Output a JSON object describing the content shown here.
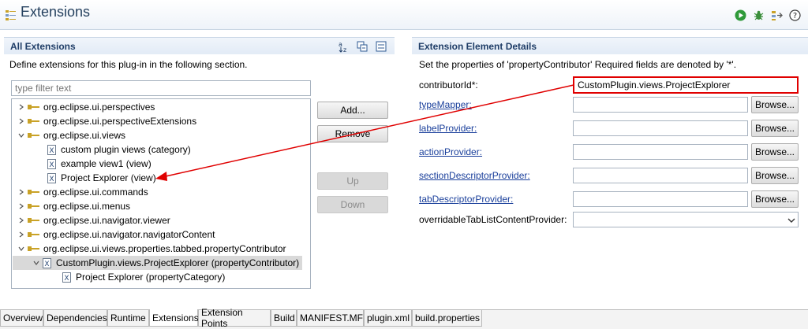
{
  "editor": {
    "title": "Extensions",
    "toolbar_icons": [
      "run-icon",
      "debug-icon",
      "export-icon",
      "help-icon"
    ]
  },
  "left_panel": {
    "header": "All Extensions",
    "description": "Define extensions for this plug-in in the following section.",
    "filter_placeholder": "type filter text",
    "icons": [
      "sort-alpha-icon",
      "collapse-all-icon",
      "show-description-icon"
    ],
    "tree": [
      {
        "label": "org.eclipse.ui.perspectives",
        "kind": "extension",
        "expander": "collapsed",
        "depth": 0
      },
      {
        "label": "org.eclipse.ui.perspectiveExtensions",
        "kind": "extension",
        "expander": "collapsed",
        "depth": 0
      },
      {
        "label": "org.eclipse.ui.views",
        "kind": "extension",
        "expander": "expanded",
        "depth": 0
      },
      {
        "label": "custom plugin views (category)",
        "kind": "element",
        "expander": "none",
        "depth": 1
      },
      {
        "label": "example view1 (view)",
        "kind": "element",
        "expander": "none",
        "depth": 1
      },
      {
        "label": "Project Explorer (view)",
        "kind": "element",
        "expander": "none",
        "depth": 1
      },
      {
        "label": "org.eclipse.ui.commands",
        "kind": "extension",
        "expander": "collapsed",
        "depth": 0
      },
      {
        "label": "org.eclipse.ui.menus",
        "kind": "extension",
        "expander": "collapsed",
        "depth": 0
      },
      {
        "label": "org.eclipse.ui.navigator.viewer",
        "kind": "extension",
        "expander": "collapsed",
        "depth": 0
      },
      {
        "label": "org.eclipse.ui.navigator.navigatorContent",
        "kind": "extension",
        "expander": "collapsed",
        "depth": 0
      },
      {
        "label": "org.eclipse.ui.views.properties.tabbed.propertyContributor",
        "kind": "extension",
        "expander": "expanded",
        "depth": 0
      },
      {
        "label": "CustomPlugin.views.ProjectExplorer (propertyContributor)",
        "kind": "element",
        "expander": "expanded",
        "depth": 1,
        "selected": true
      },
      {
        "label": "Project Explorer (propertyCategory)",
        "kind": "element",
        "expander": "none",
        "depth": 2
      }
    ],
    "buttons": {
      "add": "Add...",
      "remove": "Remove",
      "up": "Up",
      "down": "Down"
    }
  },
  "right_panel": {
    "header": "Extension Element Details",
    "description": "Set the properties of 'propertyContributor' Required fields are denoted by '*'.",
    "fields": [
      {
        "label": "contributorId*:",
        "value": "CustomPlugin.views.ProjectExplorer",
        "is_link": false,
        "has_browse": false,
        "highlighted": true
      },
      {
        "label": "typeMapper:",
        "value": "",
        "is_link": true,
        "has_browse": true
      },
      {
        "label": "labelProvider:",
        "value": "",
        "is_link": true,
        "has_browse": true
      },
      {
        "label": "actionProvider:",
        "value": "",
        "is_link": true,
        "has_browse": true
      },
      {
        "label": "sectionDescriptorProvider:",
        "value": "",
        "is_link": true,
        "has_browse": true
      },
      {
        "label": "tabDescriptorProvider:",
        "value": "",
        "is_link": true,
        "has_browse": true
      }
    ],
    "browse_label": "Browse...",
    "combo": {
      "label": "overridableTabListContentProvider:",
      "value": ""
    }
  },
  "annotation": {
    "color": "#e00000",
    "from": "contributorId field",
    "to": "Project Explorer (view)"
  },
  "tabs": [
    "Overview",
    "Dependencies",
    "Runtime",
    "Extensions",
    "Extension Points",
    "Build",
    "MANIFEST.MF",
    "plugin.xml",
    "build.properties"
  ],
  "active_tab": "Extensions",
  "colors": {
    "header_text": "#1f3d67",
    "link": "#1a3f9b",
    "highlight": "#e00000"
  }
}
